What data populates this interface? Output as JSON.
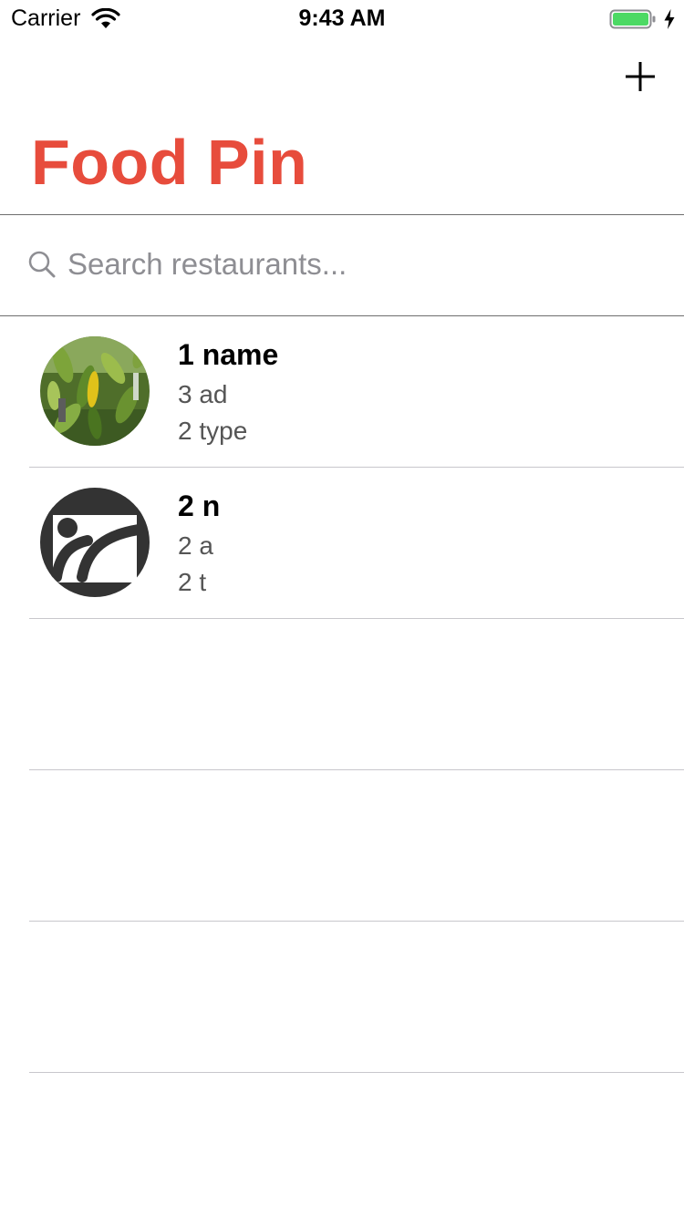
{
  "status_bar": {
    "carrier": "Carrier",
    "time": "9:43 AM"
  },
  "navigation": {
    "title": "Food Pin",
    "add_icon": "plus-icon"
  },
  "search": {
    "placeholder": "Search restaurants...",
    "value": ""
  },
  "restaurants": [
    {
      "name": "1 name",
      "location": "3 ad",
      "type": "2 type",
      "thumbnail": "leaves-photo"
    },
    {
      "name": "2 n",
      "location": "2 a",
      "type": "2 t",
      "thumbnail": "sport-pictogram"
    }
  ],
  "colors": {
    "title": "#e74c3c",
    "battery": "#4cd964",
    "placeholder": "#8e8e93",
    "secondary_text": "#555555"
  }
}
